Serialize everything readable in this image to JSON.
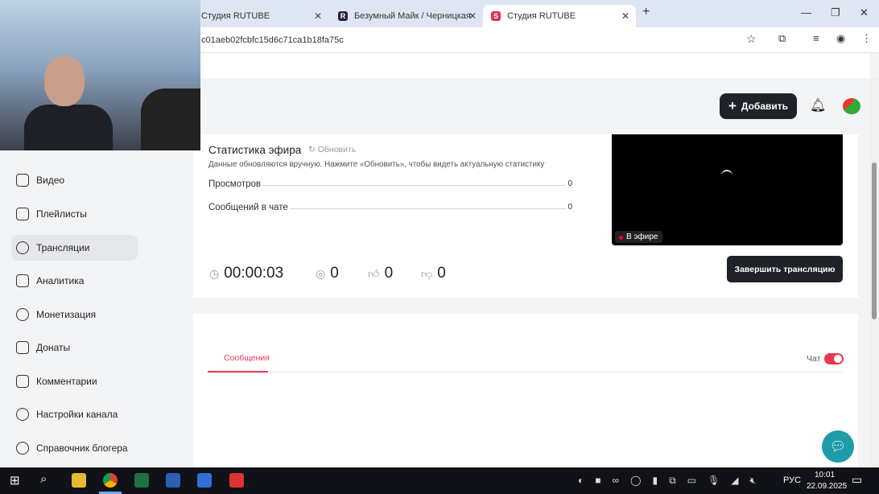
{
  "browser": {
    "tabs": [
      {
        "title": "Студия RUTUBE"
      },
      {
        "title": "Безумный Майк / Черницкая"
      },
      {
        "title": "Студия RUTUBE"
      }
    ],
    "url": "c01aeb02fcbfc15d6c71ca1b18fa75c"
  },
  "header": {
    "add_label": "Добавить"
  },
  "sidebar": {
    "items": [
      {
        "label": "Видео"
      },
      {
        "label": "Плейлисты"
      },
      {
        "label": "Трансляции"
      },
      {
        "label": "Аналитика"
      },
      {
        "label": "Монетизация"
      },
      {
        "label": "Донаты"
      },
      {
        "label": "Комментарии"
      },
      {
        "label": "Настройки канала"
      },
      {
        "label": "Справочник блогера"
      }
    ]
  },
  "stats": {
    "title": "Статистика эфира",
    "refresh": "Обновить",
    "note": "Данные обновляются вручную. Нажмите «Обновить», чтобы видеть актуальную статистику",
    "rows": [
      {
        "label": "Просмотров",
        "value": "0"
      },
      {
        "label": "Сообщений в чате",
        "value": "0"
      }
    ],
    "duration": "00:00:03",
    "viewers": "0",
    "likes": "0",
    "dislikes": "0"
  },
  "player": {
    "live_badge": "В эфире"
  },
  "end_button": "Завершить трансляцию",
  "chat": {
    "tab": "Сообщения",
    "toggle_label": "Чат",
    "toggle_on": true,
    "accent": "#e8384f"
  },
  "taskbar": {
    "lang": "РУС",
    "time": "10:01",
    "date": "22.09.2025"
  }
}
